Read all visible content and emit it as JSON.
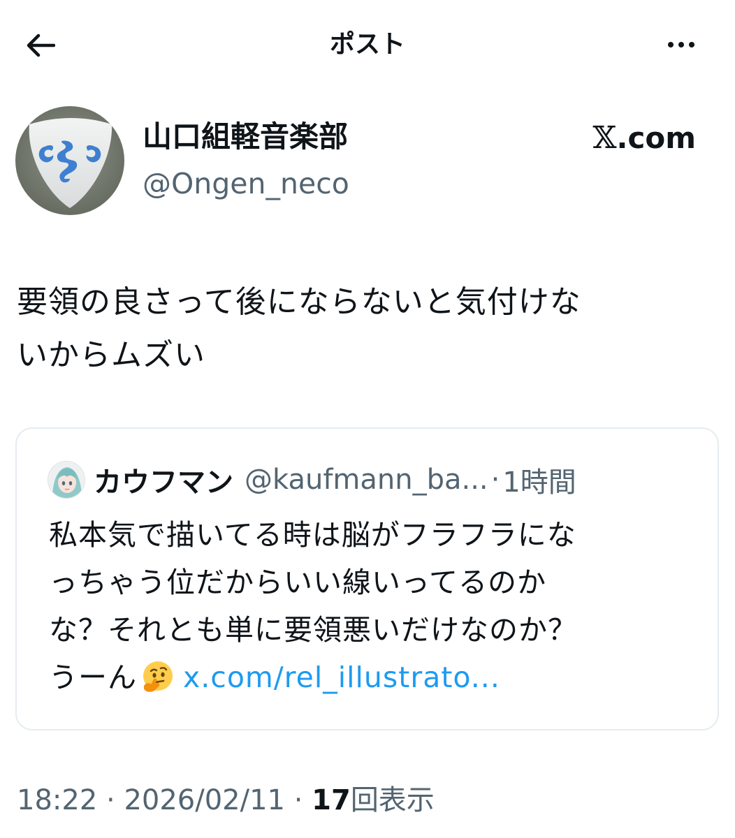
{
  "header": {
    "title": "ポスト"
  },
  "post": {
    "author_name": "山口組軽音楽部",
    "author_handle": "@Ongen_neco",
    "source_label": ".com",
    "text_line1": "要領の良さって後にならないと気付けな",
    "text_line2": "いからムズい"
  },
  "quote": {
    "author_name": "カウフマン",
    "author_handle": "@kaufmann_ba...",
    "separator": "·",
    "time": "1時間",
    "line1": "私本気で描いてる時は脳がフラフラにな",
    "line2": "っちゃう位だからいい線いってるのか",
    "line3": "な？それとも単に要領悪いだけなのか？",
    "line4_prefix": "うーん",
    "emoji": "thinking-face",
    "link": "x.com/rel_illustrato..."
  },
  "meta": {
    "time": "18:22",
    "separator": "·",
    "date": "2026/02/11",
    "views_count": "17",
    "views_label": "回表示"
  },
  "icons": {
    "back": "arrow-left-icon",
    "more": "ellipsis-icon",
    "source": "x-logo-icon"
  },
  "colors": {
    "text": "#0f1419",
    "secondary": "#536471",
    "link": "#1d9bf0",
    "border": "#e6ecf0"
  }
}
